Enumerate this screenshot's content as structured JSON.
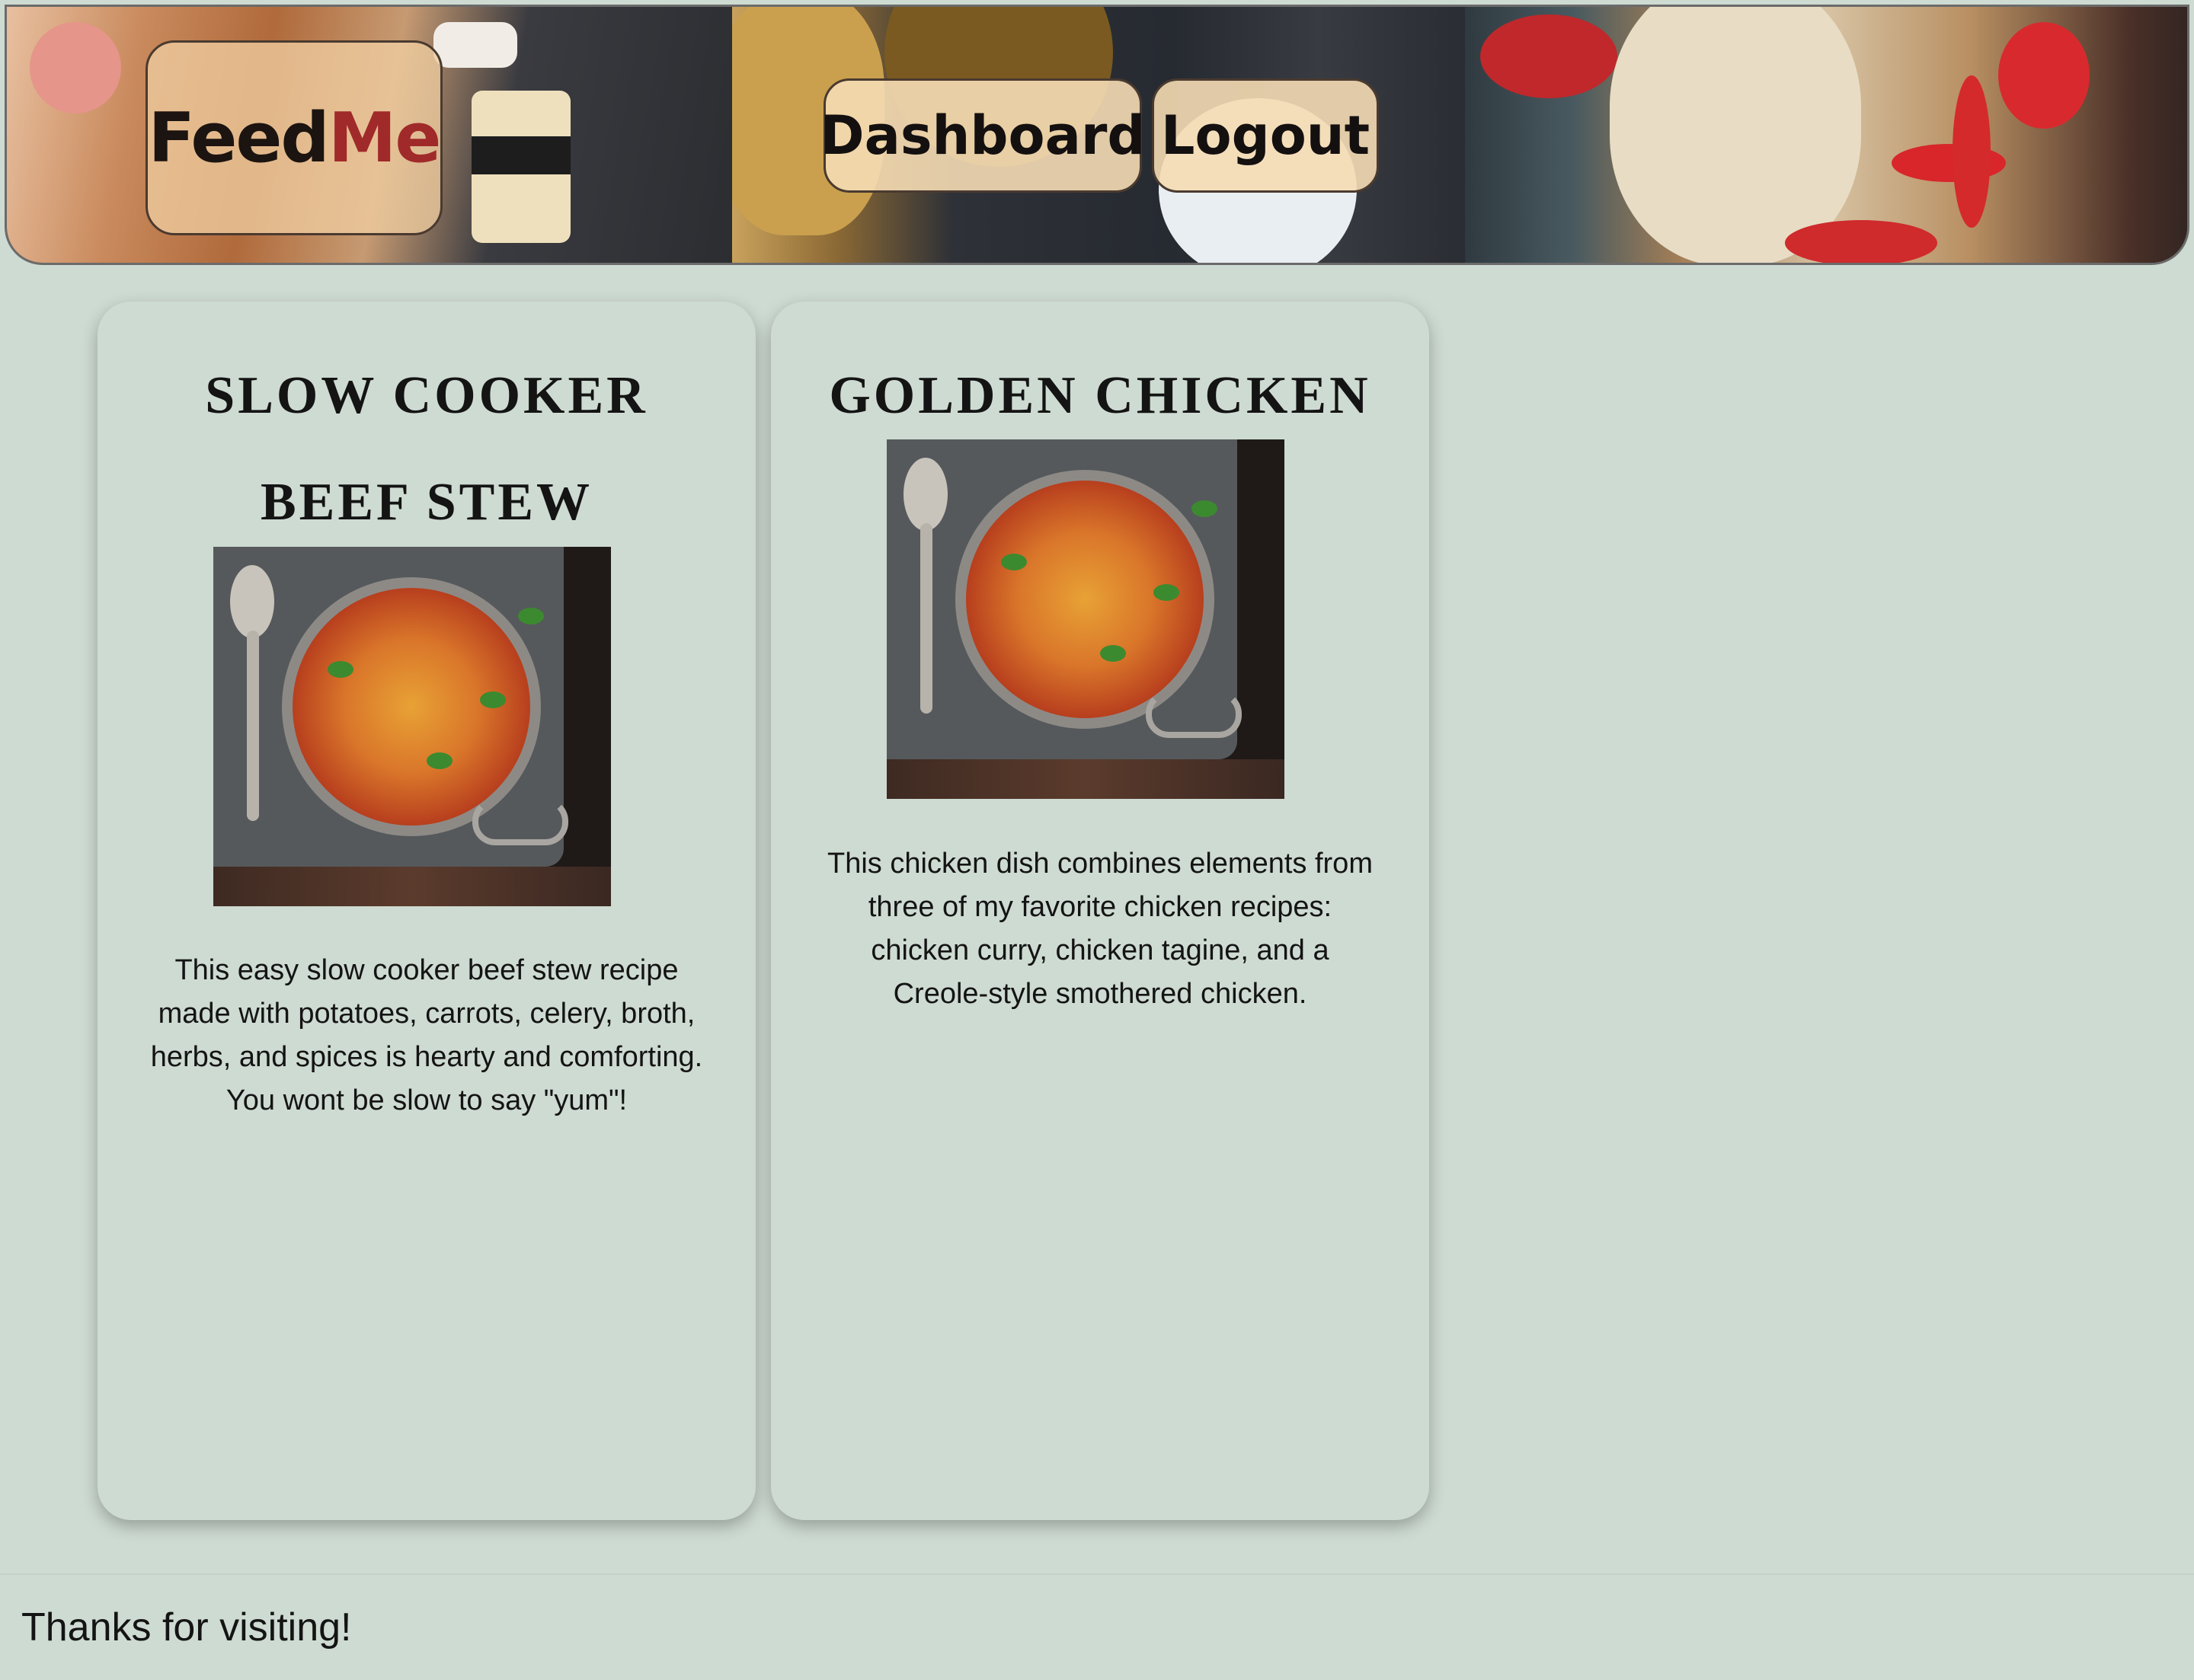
{
  "header": {
    "logo_part1": "Feed",
    "logo_part2": "Me",
    "nav": {
      "dashboard_label": "Dashboard",
      "logout_label": "Logout"
    }
  },
  "recipes": [
    {
      "title_line1": "SLOW COOKER",
      "title_line2": "BEEF STEW",
      "image": "gnocchi-skillet-photo",
      "description": "This easy slow cooker beef stew recipe made with potatoes, carrots, celery, broth, herbs, and spices is hearty and comforting. You wont be slow to say \"yum\"!"
    },
    {
      "title_line1": "GOLDEN CHICKEN",
      "image": "gnocchi-skillet-photo",
      "description": "This chicken dish combines elements from three of my favorite chicken recipes: chicken curry, chicken tagine, and a Creole-style smothered chicken."
    }
  ],
  "footer": {
    "text": "Thanks for visiting!"
  },
  "colors": {
    "page_background": "#cedbd2",
    "logo_accent": "#a02a2a",
    "button_fill": "#f5dcb4"
  }
}
